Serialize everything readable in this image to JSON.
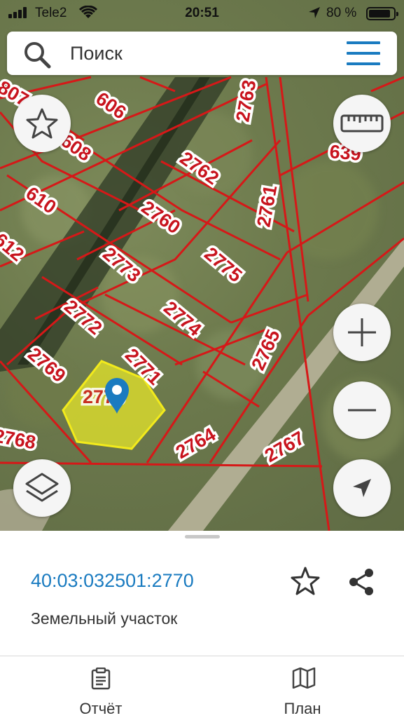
{
  "status_bar": {
    "carrier": "Tele2",
    "time": "20:51",
    "battery_percent": "80 %"
  },
  "search": {
    "placeholder": "Поиск"
  },
  "map": {
    "parcel_labels": [
      "807",
      "606",
      "2763",
      "608",
      "2762",
      "639",
      "610",
      "2760",
      "2761",
      "612",
      "2773",
      "2775",
      "2772",
      "2774",
      "2765",
      "2769",
      "2771",
      "2770",
      "2768",
      "2764",
      "2767"
    ],
    "selected_parcel_label": "2770",
    "highlight_color": "#e6e62a",
    "boundary_color": "#d61818"
  },
  "sheet": {
    "cadastral_number": "40:03:032501:2770",
    "object_type": "Земельный участок"
  },
  "bottom_nav": {
    "report_label": "Отчёт",
    "plan_label": "План"
  },
  "colors": {
    "accent": "#1a7bc0"
  }
}
